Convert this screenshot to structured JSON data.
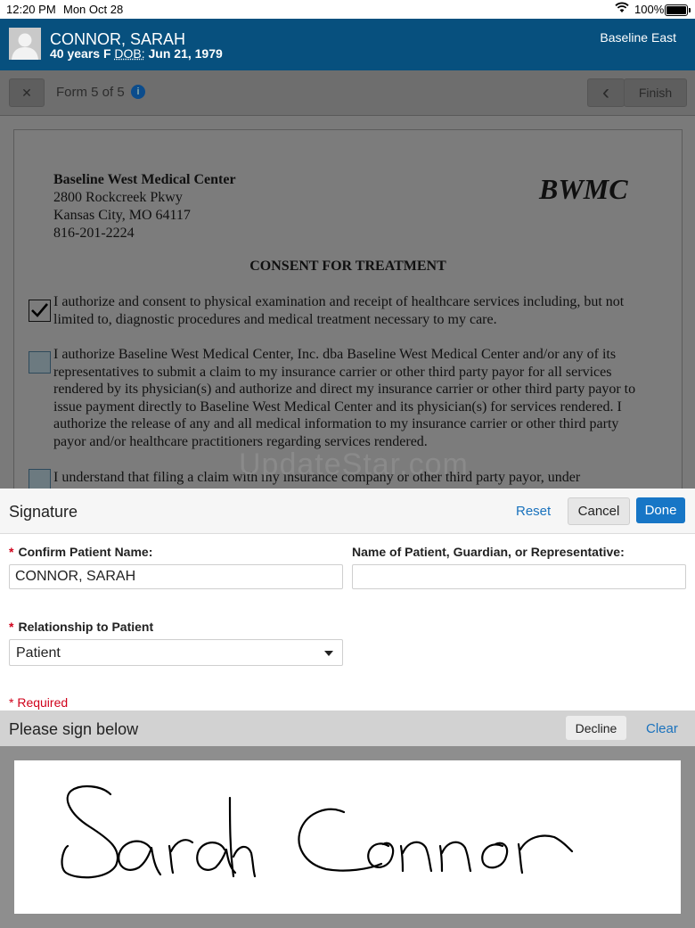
{
  "status_bar": {
    "time": "12:20 PM",
    "date": "Mon Oct 28",
    "battery": "100%"
  },
  "patient": {
    "name": "CONNOR, SARAH",
    "age_sex": "40 years F",
    "dob_label": "DOB:",
    "dob": "Jun 21, 1979",
    "facility": "Baseline East"
  },
  "toolbar": {
    "close": "✕",
    "form_progress": "Form 5 of 5",
    "info": "i",
    "back": "‹",
    "finish": "Finish"
  },
  "document": {
    "org_name": "Baseline West Medical Center",
    "address1": "2800 Rockcreek Pkwy",
    "address2": "Kansas City, MO 64117",
    "phone": "816-201-2224",
    "logo": "BWMC",
    "title": "CONSENT FOR TREATMENT",
    "clauses": [
      {
        "checked": true,
        "text": "I authorize and consent to physical examination and receipt of healthcare services including, but not limited to, diagnostic procedures and medical treatment necessary to my care."
      },
      {
        "checked": false,
        "text": "I authorize Baseline West Medical Center, Inc. dba Baseline West Medical Center and/or any of its representatives to submit a claim to my insurance carrier or other third party payor for all services rendered by its physician(s) and authorize and direct my insurance carrier or other third party payor to issue payment directly to Baseline West Medical Center and its physician(s) for services rendered. I authorize the release of any and all medical information to my insurance carrier or other third party payor and/or healthcare practitioners regarding services rendered."
      },
      {
        "checked": false,
        "text": "I understand that filing a claim with my insurance company or other third party payor, under"
      }
    ],
    "watermark": "UpdateStar.com"
  },
  "signature": {
    "title": "Signature",
    "reset": "Reset",
    "cancel": "Cancel",
    "done": "Done",
    "confirm_label": "Confirm Patient Name:",
    "confirm_value": "CONNOR, SARAH",
    "rep_label": "Name of Patient, Guardian, or Representative:",
    "rep_value": "",
    "relationship_label": "Relationship to Patient",
    "relationship_value": "Patient",
    "required_note": "* Required",
    "sign_prompt": "Please sign below",
    "decline": "Decline",
    "clear": "Clear",
    "ink_color": "#000000"
  },
  "colors": {
    "header_blue": "#07507e",
    "accent_blue": "#1776c6",
    "required_red": "#d0021b"
  }
}
